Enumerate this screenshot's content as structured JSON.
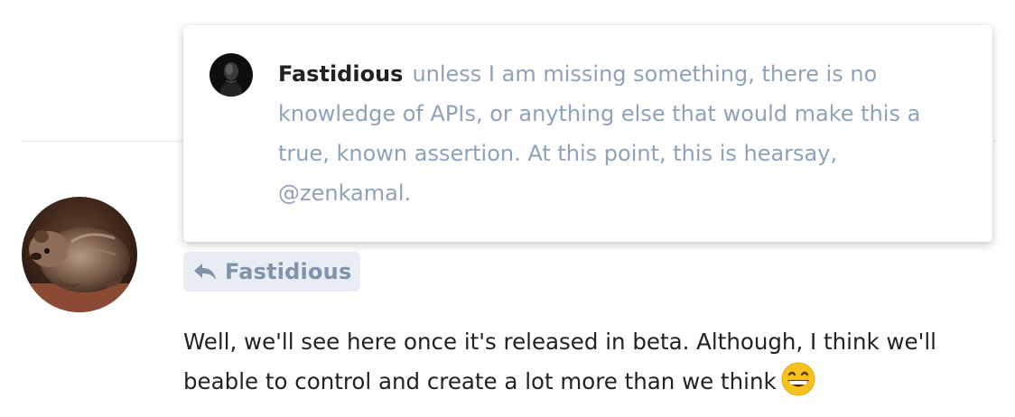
{
  "quote": {
    "author": "Fastidious",
    "text": "unless I am missing something, there is no knowledge of APIs, or anything else that would make this a true, known assertion. At this point, this is hearsay, @zenkamal."
  },
  "reply_to": {
    "name": "Fastidious",
    "icon": "reply-arrow-icon"
  },
  "post": {
    "body": "Well, we'll see here once it's released in beta. Although, I think we'll beable to control and create a lot more than we think",
    "emoji": "grinning-face-emoji"
  },
  "colors": {
    "reply_chip_bg": "#e8edf3",
    "reply_chip_text": "#7f93aa",
    "quote_text": "#8ea2ba",
    "body_text": "#222222"
  }
}
